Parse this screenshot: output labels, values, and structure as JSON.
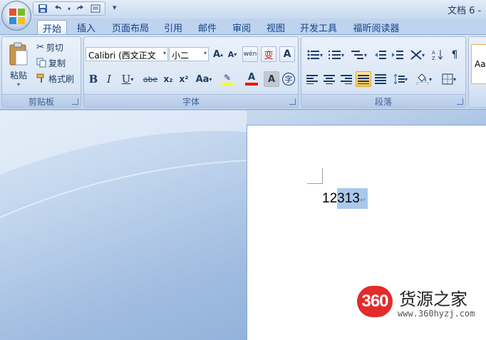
{
  "window": {
    "title": "文档 6 -"
  },
  "quick_access": {
    "more_label": "▾"
  },
  "tabs": [
    {
      "label": "开始",
      "active": true
    },
    {
      "label": "插入"
    },
    {
      "label": "页面布局"
    },
    {
      "label": "引用"
    },
    {
      "label": "邮件"
    },
    {
      "label": "审阅"
    },
    {
      "label": "视图"
    },
    {
      "label": "开发工具"
    },
    {
      "label": "福昕阅读器"
    }
  ],
  "clipboard": {
    "label": "剪贴板",
    "paste": "粘贴",
    "cut": "剪切",
    "copy": "复制",
    "format_painter": "格式刷"
  },
  "font": {
    "label": "字体",
    "font_name": "Calibri (西文正文",
    "font_size": "小二",
    "grow": "A",
    "shrink": "A",
    "bold": "B",
    "italic": "I",
    "underline": "U",
    "strikethrough": "abe",
    "subscript": "x₂",
    "superscript": "x²",
    "change_case": "Aa",
    "font_color": "A",
    "char_shading": "A",
    "enclose": "字",
    "phonetic": "wén",
    "char_border": "A",
    "clear_format": "变"
  },
  "paragraph": {
    "label": "段落"
  },
  "styles": {
    "preview": "Aa"
  },
  "document": {
    "text_plain": "12",
    "text_selected": "313",
    "para_mark": "↵"
  },
  "watermark": {
    "logo_text": "360",
    "site_name": "货源之家",
    "url": "www.360hyzj.com"
  },
  "colors": {
    "accent": "#15428b",
    "selection": "#a9c8ec",
    "highlight": "#ffff00",
    "font_color_bar": "#ff0000",
    "watermark_red": "#e32b2b"
  }
}
